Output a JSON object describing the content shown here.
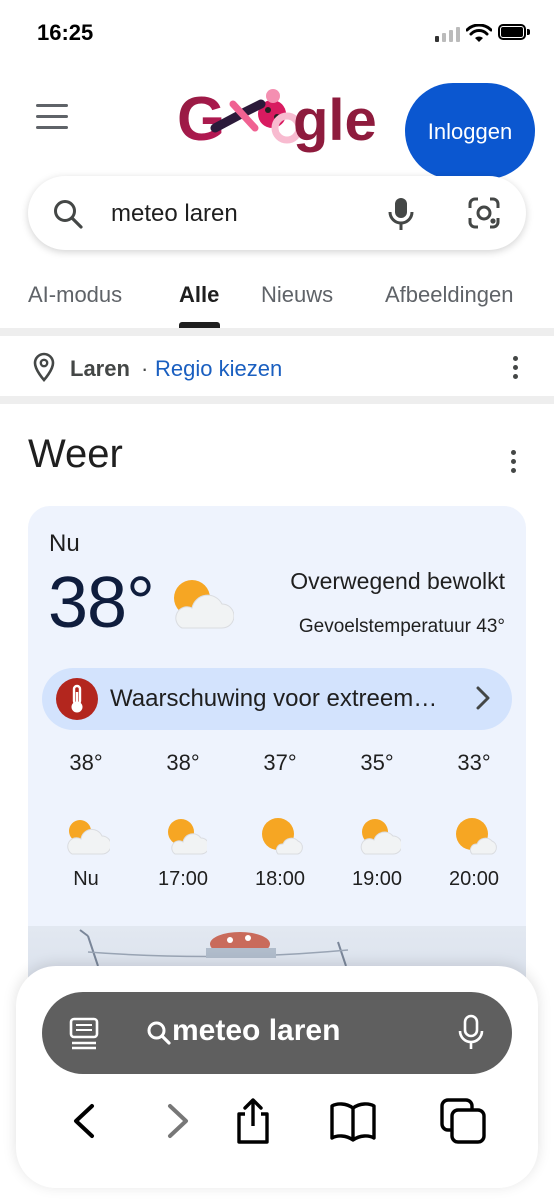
{
  "status_bar": {
    "time": "16:25"
  },
  "header": {
    "login_label": "Inloggen"
  },
  "search": {
    "query": "meteo laren"
  },
  "tabs": [
    {
      "label": "AI-modus",
      "active": false
    },
    {
      "label": "Alle",
      "active": true
    },
    {
      "label": "Nieuws",
      "active": false
    },
    {
      "label": "Afbeeldingen",
      "active": false
    }
  ],
  "location": {
    "city": "Laren",
    "separator": "·",
    "change_link": "Regio kiezen"
  },
  "weather": {
    "title": "Weer",
    "now_label": "Nu",
    "temperature": "38°",
    "condition": "Overwegend bewolkt",
    "feels_like": "Gevoelstemperatuur 43°",
    "warning": "Waarschuwing voor extreem…",
    "hourly": [
      {
        "temp": "38°",
        "time": "Nu",
        "icon": "partly-cloudy-icon"
      },
      {
        "temp": "38°",
        "time": "17:00",
        "icon": "partly-cloudy-icon"
      },
      {
        "temp": "37°",
        "time": "18:00",
        "icon": "mostly-sunny-icon"
      },
      {
        "temp": "35°",
        "time": "19:00",
        "icon": "partly-cloudy-icon"
      },
      {
        "temp": "33°",
        "time": "20:00",
        "icon": "mostly-sunny-icon"
      }
    ]
  },
  "browser_bar": {
    "address": "meteo laren"
  },
  "colors": {
    "accent": "#0b57d0",
    "link": "#1a5fc0",
    "warning": "#b3261e",
    "card_bg": "#eef3fd"
  }
}
